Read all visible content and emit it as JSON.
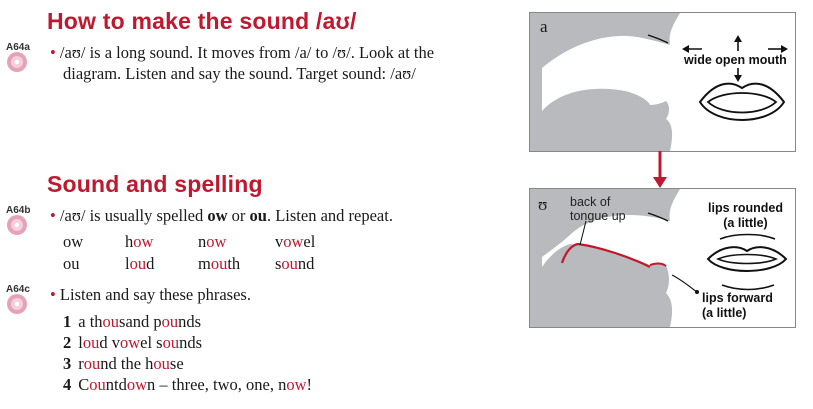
{
  "section1": {
    "title": "How to make the sound /aʊ/",
    "track": "A64a",
    "line1": "/aʊ/ is a long sound. It moves from /a/ to /ʊ/. Look at the",
    "line2": "diagram. Listen and say the sound. Target sound: /aʊ/"
  },
  "section2": {
    "title": "Sound and spelling",
    "track_b": "A64b",
    "instruction_b": {
      "pre": "/aʊ/ is usually spelled ",
      "ow": "ow",
      "mid": " or ",
      "ou": "ou",
      "post": ". Listen and repeat."
    },
    "rows": [
      {
        "spelling": "ow",
        "words": [
          {
            "pre": "h",
            "red": "ow",
            "post": ""
          },
          {
            "pre": "n",
            "red": "ow",
            "post": ""
          },
          {
            "pre": "v",
            "red": "ow",
            "post": "el"
          }
        ]
      },
      {
        "spelling": "ou",
        "words": [
          {
            "pre": "l",
            "red": "ou",
            "post": "d"
          },
          {
            "pre": "m",
            "red": "ou",
            "post": "th"
          },
          {
            "pre": "s",
            "red": "ou",
            "post": "nd"
          }
        ]
      }
    ],
    "track_c": "A64c",
    "instruction_c": "Listen and say these phrases.",
    "phrases": [
      {
        "num": "1",
        "parts": [
          [
            "a th",
            false
          ],
          [
            "ou",
            true
          ],
          [
            "sand p",
            false
          ],
          [
            "ou",
            true
          ],
          [
            "nds",
            false
          ]
        ]
      },
      {
        "num": "2",
        "parts": [
          [
            "l",
            false
          ],
          [
            "ou",
            true
          ],
          [
            "d v",
            false
          ],
          [
            "ow",
            true
          ],
          [
            "el s",
            false
          ],
          [
            "ou",
            true
          ],
          [
            "nds",
            false
          ]
        ]
      },
      {
        "num": "3",
        "parts": [
          [
            "r",
            false
          ],
          [
            "ou",
            true
          ],
          [
            "nd the h",
            false
          ],
          [
            "ou",
            true
          ],
          [
            "se",
            false
          ]
        ]
      },
      {
        "num": "4",
        "parts": [
          [
            "C",
            false
          ],
          [
            "ou",
            true
          ],
          [
            "ntd",
            false
          ],
          [
            "ow",
            true
          ],
          [
            "n – three, two, one, n",
            false
          ],
          [
            "ow",
            true
          ],
          [
            "!",
            false
          ]
        ]
      }
    ]
  },
  "diagram_a": {
    "label": "a",
    "mouth_label": "wide open mouth"
  },
  "diagram_b": {
    "label": "ʊ",
    "tongue_label_1": "back of",
    "tongue_label_2": "tongue up",
    "lips_rounded_1": "lips rounded",
    "lips_rounded_2": "(a little)",
    "lips_forward_1": "lips forward",
    "lips_forward_2": "(a little)"
  },
  "colors": {
    "accent": "#c0182e",
    "diagram_gray": "#b9babd"
  },
  "icons": [
    "audio-cd-icon",
    "bullet-icon",
    "arrow-down-icon"
  ]
}
